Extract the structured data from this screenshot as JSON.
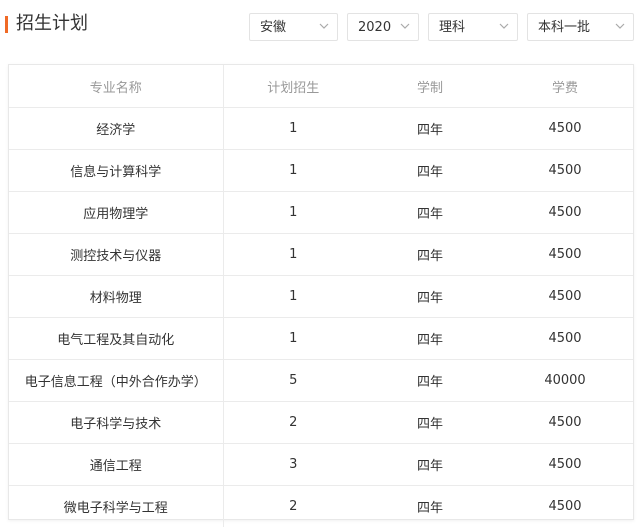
{
  "header": {
    "title": "招生计划"
  },
  "filters": {
    "province": "安徽",
    "year": "2020",
    "subject": "理科",
    "batch": "本科一批"
  },
  "icons": {
    "dropdown": "chevron-down-icon"
  },
  "colors": {
    "accent": "#f06a26",
    "header_text": "#999999",
    "border": "#ebebeb"
  },
  "table": {
    "columns": [
      "专业名称",
      "计划招生",
      "学制",
      "学费"
    ],
    "rows": [
      {
        "major": "经济学",
        "plan": "1",
        "duration": "四年",
        "fee": "4500"
      },
      {
        "major": "信息与计算科学",
        "plan": "1",
        "duration": "四年",
        "fee": "4500"
      },
      {
        "major": "应用物理学",
        "plan": "1",
        "duration": "四年",
        "fee": "4500"
      },
      {
        "major": "测控技术与仪器",
        "plan": "1",
        "duration": "四年",
        "fee": "4500"
      },
      {
        "major": "材料物理",
        "plan": "1",
        "duration": "四年",
        "fee": "4500"
      },
      {
        "major": "电气工程及其自动化",
        "plan": "1",
        "duration": "四年",
        "fee": "4500"
      },
      {
        "major": "电子信息工程（中外合作办学）",
        "plan": "5",
        "duration": "四年",
        "fee": "40000"
      },
      {
        "major": "电子科学与技术",
        "plan": "2",
        "duration": "四年",
        "fee": "4500"
      },
      {
        "major": "通信工程",
        "plan": "3",
        "duration": "四年",
        "fee": "4500"
      },
      {
        "major": "微电子科学与工程",
        "plan": "2",
        "duration": "四年",
        "fee": "4500"
      }
    ]
  }
}
